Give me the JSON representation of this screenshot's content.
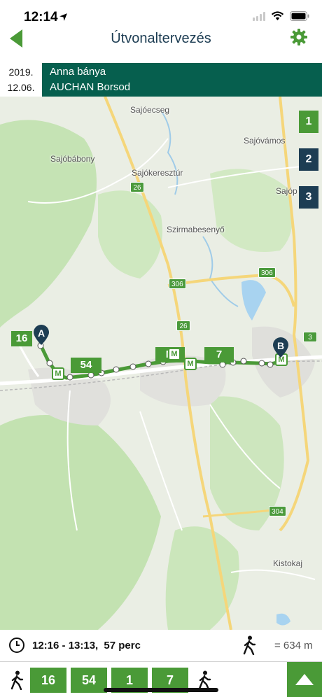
{
  "status_bar": {
    "time": "12:14",
    "icons": [
      "location-arrow-icon",
      "cellular-icon",
      "wifi-icon",
      "battery-icon"
    ]
  },
  "nav": {
    "title": "Útvonaltervezés",
    "back_icon": "back-triangle-icon",
    "settings_icon": "gear-icon"
  },
  "route_header": {
    "date_line1": "2019.",
    "date_line2": "12.06.",
    "from": "Anna bánya",
    "to": "AUCHAN Borsod"
  },
  "map": {
    "place_labels": [
      "Sajóecseg",
      "Sajóvámos",
      "Sajóbábony",
      "Sajókeresztúr",
      "Sajóp",
      "Szirmabesenyő",
      "Kistokaj"
    ],
    "road_numbers": [
      "26",
      "306",
      "306",
      "26",
      "3",
      "304"
    ],
    "pin_a": "A",
    "pin_b": "B",
    "line_labels": [
      "16",
      "54",
      "7"
    ],
    "metro_symbol": "M",
    "alternatives": [
      "1",
      "2",
      "3"
    ]
  },
  "summary": {
    "time_range": "12:16 - 13:13,",
    "duration": "57 perc",
    "walk_distance": "= 634 m"
  },
  "legs": [
    "16",
    "54",
    "1",
    "7"
  ],
  "colors": {
    "primary_green": "#4a9a37",
    "dark_teal": "#065f4e",
    "navy": "#1d3d53",
    "map_bg": "#eaeee4"
  }
}
